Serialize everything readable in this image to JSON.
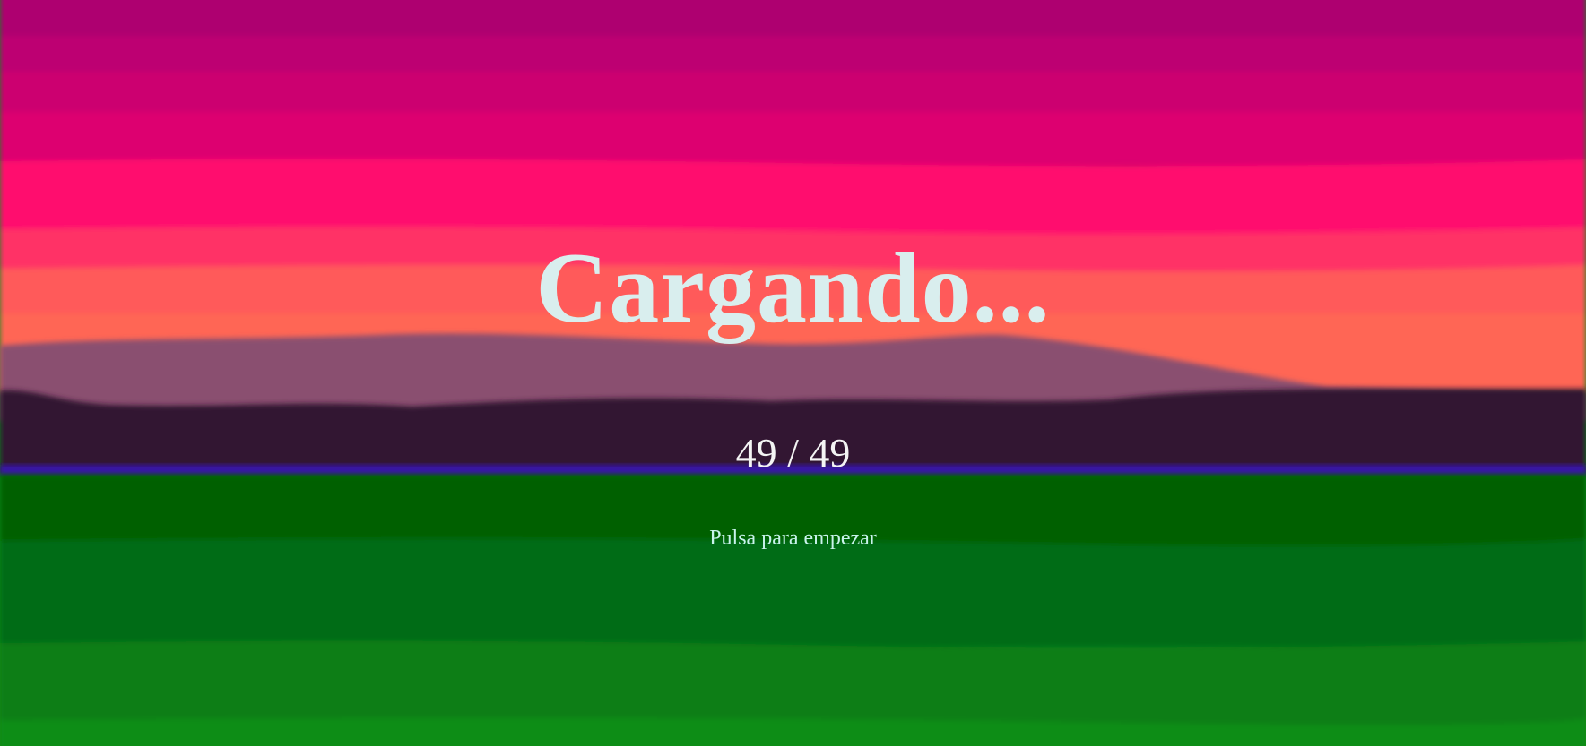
{
  "loading_screen": {
    "title": "Cargando...",
    "progress_text": "49 / 49",
    "progress": {
      "loaded": 49,
      "total": 49
    },
    "start_prompt": "Pulsa para empezar"
  },
  "colors": {
    "sky_top": "#ae0070",
    "sky_mid": "#ff0a6e",
    "sky_horizon": "#ff6655",
    "mountain_far": "#8a5070",
    "mountain_near": "#331533",
    "water_line": "#3818a8",
    "grass_dark": "#056005",
    "grass_light": "#088d19",
    "title_text": "#d9eeee",
    "prompt_text": "#c9f3ec"
  }
}
